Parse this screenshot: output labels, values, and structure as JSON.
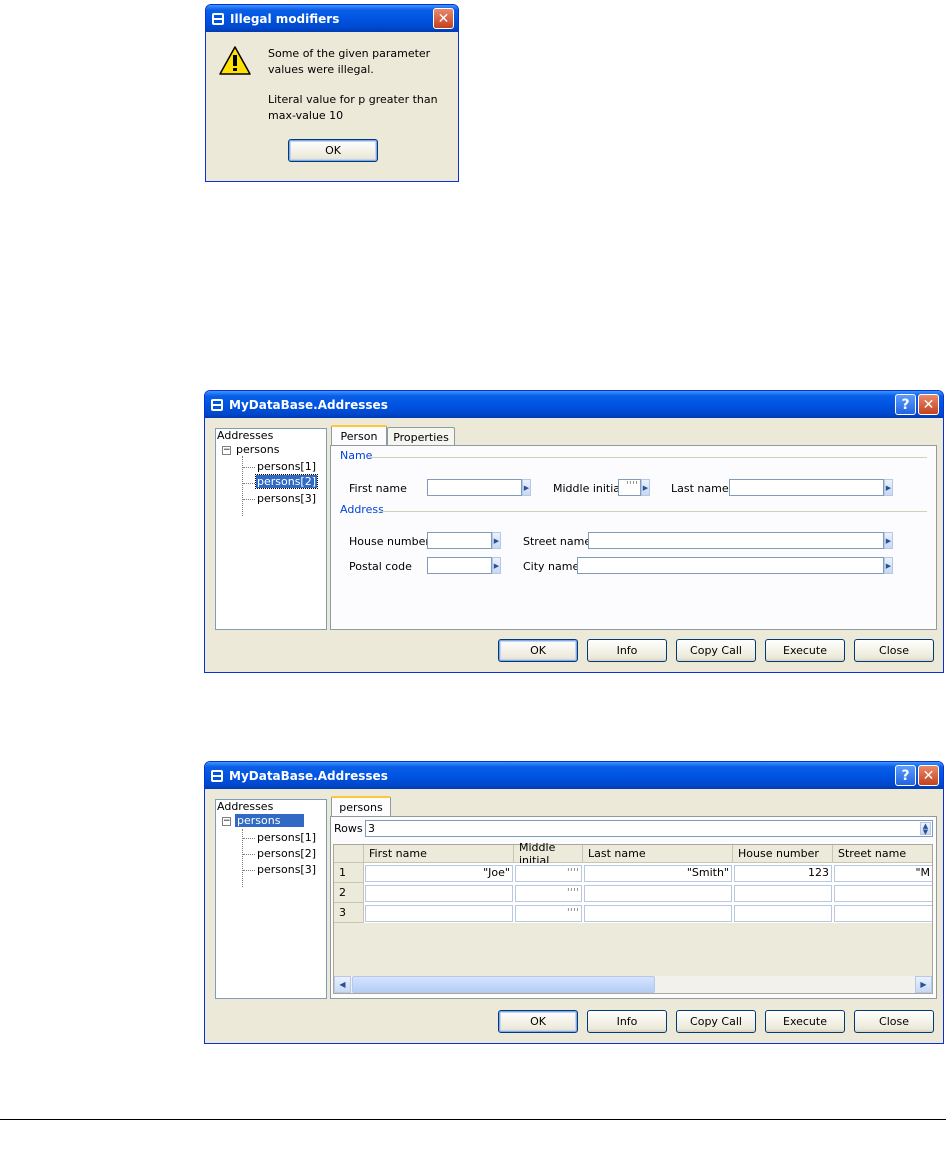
{
  "dialog": {
    "title": "Illegal modifiers",
    "message1": "Some of the given parameter",
    "message1b": "values were illegal.",
    "message2": "Literal value for p greater than",
    "message2b": "max-value 10",
    "ok_label": "OK"
  },
  "window1": {
    "title": "MyDataBase.Addresses",
    "tree": {
      "root": "Addresses",
      "node": "persons",
      "children": [
        "persons[1]",
        "persons[2]",
        "persons[3]"
      ],
      "selected": "persons[2]"
    },
    "tabs": [
      "Person",
      "Properties"
    ],
    "name_group": "Name",
    "address_group": "Address",
    "labels": {
      "first_name": "First name",
      "middle_initial": "Middle initial",
      "last_name": "Last name",
      "house_number": "House number",
      "street_name": "Street name",
      "postal_code": "Postal code",
      "city_name": "City name"
    },
    "middle_initial_value": "''''",
    "buttons": [
      "OK",
      "Info",
      "Copy Call",
      "Execute",
      "Close"
    ]
  },
  "window2": {
    "title": "MyDataBase.Addresses",
    "tree": {
      "root": "Addresses",
      "node": "persons",
      "children": [
        "persons[1]",
        "persons[2]",
        "persons[3]"
      ],
      "selected": "persons"
    },
    "tab": "persons",
    "rows_label": "Rows",
    "rows_value": "3",
    "columns": [
      "First name",
      "Middle initial",
      "Last name",
      "House number",
      "Street name"
    ],
    "rows": [
      {
        "num": "1",
        "cells": [
          "\"Joe\"",
          "''''",
          "\"Smith\"",
          "123",
          "\"M"
        ]
      },
      {
        "num": "2",
        "cells": [
          "",
          "''''",
          "",
          "",
          ""
        ]
      },
      {
        "num": "3",
        "cells": [
          "",
          "''''",
          "",
          "",
          ""
        ]
      }
    ],
    "buttons": [
      "OK",
      "Info",
      "Copy Call",
      "Execute",
      "Close"
    ]
  },
  "colors": {
    "titlebar": "#0054e3",
    "selection": "#316ac5",
    "group_label": "#0046d5"
  }
}
